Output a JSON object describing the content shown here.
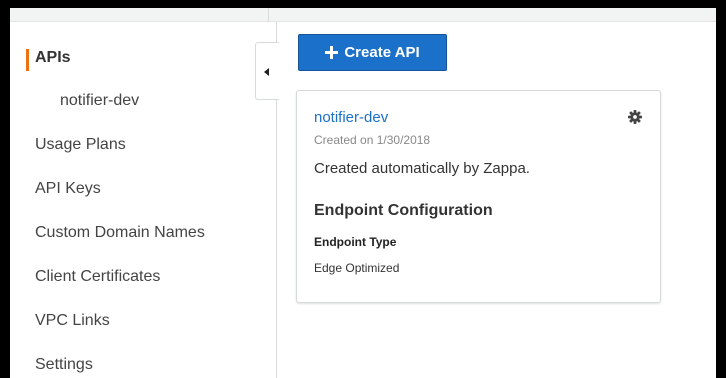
{
  "sidebar": {
    "items": [
      {
        "label": "APIs"
      },
      {
        "label": "notifier-dev"
      },
      {
        "label": "Usage Plans"
      },
      {
        "label": "API Keys"
      },
      {
        "label": "Custom Domain Names"
      },
      {
        "label": "Client Certificates"
      },
      {
        "label": "VPC Links"
      },
      {
        "label": "Settings"
      }
    ],
    "active_color": "#ec7211"
  },
  "toolbar": {
    "create_label": "Create API",
    "create_icon": "plus-icon",
    "button_color": "#1b71ca"
  },
  "api_card": {
    "name": "notifier-dev",
    "created": "Created on 1/30/2018",
    "description": "Created automatically by Zappa.",
    "endpoint_title": "Endpoint Configuration",
    "endpoint_type_label": "Endpoint Type",
    "endpoint_type_value": "Edge Optimized",
    "settings_icon": "gear-icon",
    "link_color": "#1b71ca"
  }
}
